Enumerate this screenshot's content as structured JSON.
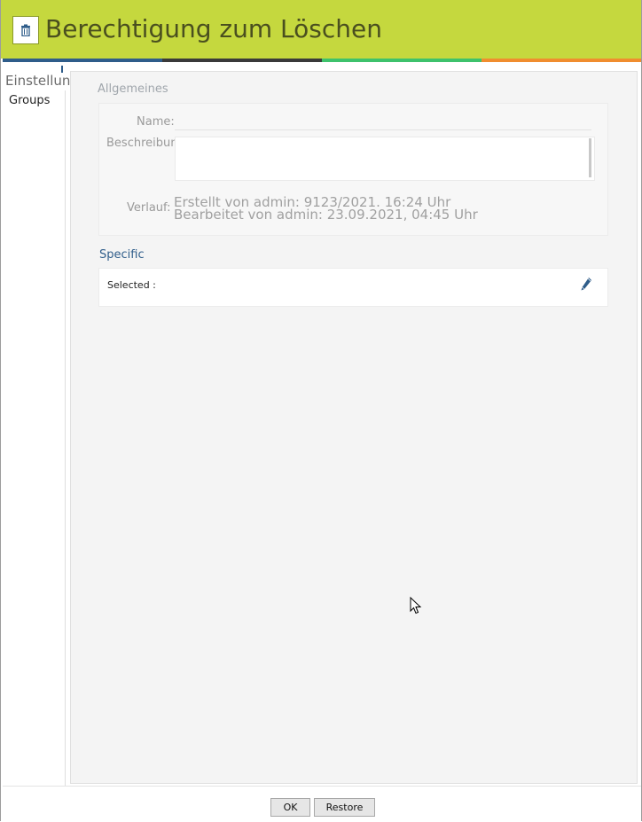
{
  "header": {
    "title": "Berechtigung zum Löschen",
    "icon": "trash-icon",
    "bg_color": "#c5d83e",
    "stripe_colors": [
      "#2f5d8a",
      "#3a3a3a",
      "#3ec26c",
      "#f08d2f"
    ]
  },
  "nav": {
    "heading": "Einstellungen",
    "items": [
      {
        "label": "Groups"
      }
    ]
  },
  "general": {
    "title": "Allgemeines",
    "name_label": "Name:",
    "name_value": "",
    "description_label": "Beschreibung",
    "description_value": "",
    "history_label": "Verlauf:",
    "history_created": "Erstellt von admin: 9123/2021. 16:24 Uhr",
    "history_edited": "Bearbeitet von admin: 23.09.2021, 04:45 Uhr"
  },
  "specific": {
    "title": "Specific",
    "selected_label": "Selected :",
    "edit_icon": "pencil-icon"
  },
  "footer": {
    "ok_label": "OK",
    "restore_label": "Restore"
  }
}
